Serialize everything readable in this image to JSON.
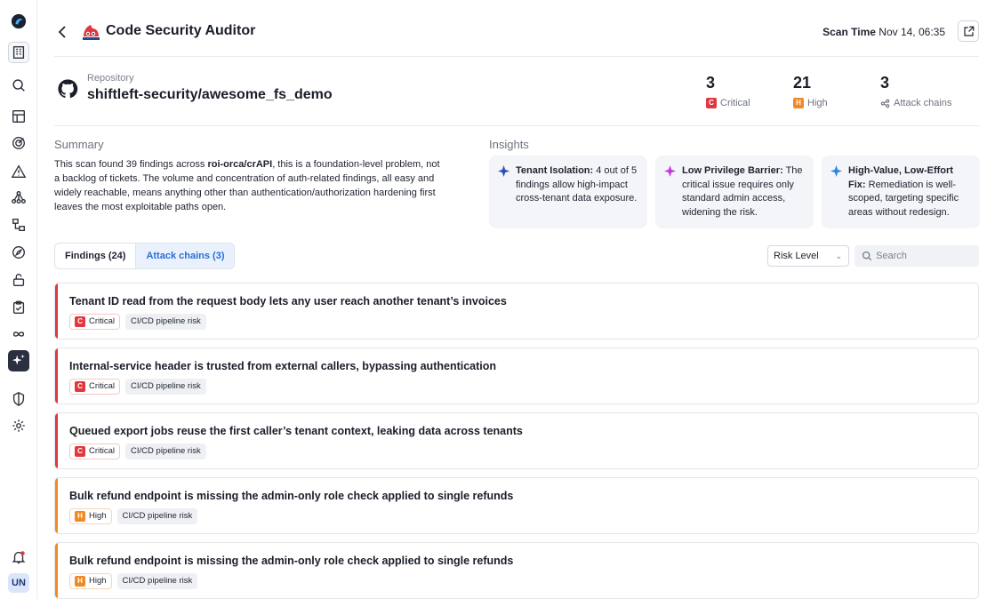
{
  "header": {
    "title": "Code Security Auditor",
    "scan_time_label": "Scan Time",
    "scan_time_value": "Nov 14, 06:35"
  },
  "repository": {
    "label": "Repository",
    "name": "shiftleft-security/awesome_fs_demo"
  },
  "stats": [
    {
      "value": "3",
      "label": "Critical",
      "badge": "C"
    },
    {
      "value": "21",
      "label": "High",
      "badge": "H"
    },
    {
      "value": "3",
      "label": "Attack chains"
    }
  ],
  "summary": {
    "title": "Summary",
    "text_1": "This scan found 39 findings across ",
    "repo_ref": "roi-orca/crAPI",
    "text_2": ",  this is a foundation-level problem, not a backlog of tickets. The volume and concentration of auth-related findings, all easy and widely reachable, means anything other than authentication/authorization hardening first leaves the most exploitable paths open."
  },
  "insights": {
    "title": "Insights",
    "items": [
      {
        "heading": "Tenant Isolation:",
        "text": " 4 out of 5 findings allow high-impact cross-tenant data exposure.",
        "color": "#2c4fb8"
      },
      {
        "heading": "Low Privilege Barrier:",
        "text": " The critical issue requires only standard admin access, widening the risk.",
        "color": "#c23bd9"
      },
      {
        "heading": "High-Value, Low-Effort Fix:",
        "text": " Remediation is well-scoped, targeting specific areas without redesign.",
        "color": "#2f86e6"
      }
    ]
  },
  "tabs": {
    "findings": "Findings (24)",
    "attack_chains": "Attack chains (3)"
  },
  "filters": {
    "risk_level": "Risk Level",
    "search_placeholder": "Search"
  },
  "findings": [
    {
      "title": "Tenant ID read from the request body lets any user reach another tenant’s invoices",
      "severity": "Critical",
      "badge": "C",
      "category": "CI/CD pipeline risk"
    },
    {
      "title": "Internal-service header is trusted from external callers, bypassing authentication",
      "severity": "Critical",
      "badge": "C",
      "category": "CI/CD pipeline risk"
    },
    {
      "title": "Queued export jobs reuse the first caller’s tenant context, leaking data across tenants",
      "severity": "Critical",
      "badge": "C",
      "category": "CI/CD pipeline risk"
    },
    {
      "title": "Bulk refund endpoint is missing the admin-only role check applied to single refunds",
      "severity": "High",
      "badge": "H",
      "category": "CI/CD pipeline risk"
    },
    {
      "title": "Bulk refund endpoint is missing the admin-only role check applied to single refunds",
      "severity": "High",
      "badge": "H",
      "category": "CI/CD pipeline risk"
    }
  ],
  "colors": {
    "critical": "#e0383e",
    "high": "#f08a24",
    "accent": "#2a6fd6"
  },
  "sidebar": {
    "avatar": "UN",
    "icons": [
      "orca-logo-icon",
      "building-icon",
      "search-icon",
      "dashboard-icon",
      "target-icon",
      "alert-triangle-icon",
      "network-icon",
      "hierarchy-icon",
      "compass-icon",
      "unlock-icon",
      "clipboard-check-icon",
      "infinity-icon",
      "sparkles-icon",
      "shield-icon",
      "gear-icon",
      "bell-icon"
    ]
  }
}
